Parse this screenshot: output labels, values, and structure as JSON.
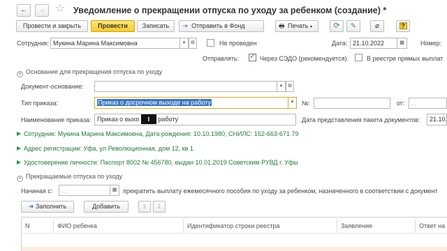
{
  "window": {
    "title": "Уведомление о прекращении отпуска по уходу за ребенком (создание) *"
  },
  "toolbar": {
    "post_close": "Провести и закрыть",
    "post": "Провести",
    "save": "Записать",
    "send_fund": "Отправить в Фонд",
    "print": "Печать"
  },
  "header": {
    "employee_label": "Сотрудник:",
    "employee_value": "Мукина Марина Максимовна",
    "not_posted_label": "Не проведен",
    "date_label": "Дата:",
    "date_value": "21.10.2022",
    "number_label": "Номер:",
    "send_label": "Отправлять:",
    "via_sedo_label": "Через СЭДО (рекомендуется)",
    "registry_label": "В реестре прямых выплат"
  },
  "basis": {
    "section_title": "Основание для прекращения отпуска по уходу",
    "doc_basis_label": "Документ-основание:",
    "doc_basis_value": "",
    "order_type_label": "Тип приказа:",
    "order_type_value": "Приказ о досрочном выходе на работу",
    "number_label": "№:",
    "from_label": "от:",
    "from_value": " .  .",
    "order_name_label": "Наименование приказа:",
    "order_name_part1": "Приказ о выхо",
    "order_name_part2": "работу",
    "package_date_label": "Дата представления пакета документов:",
    "package_date_value": "21.10."
  },
  "links": {
    "employee_info": "Сотрудник: Мукина Марина Максимовна, Дата рождения: 10.10.1980, СНИЛС: 152-663-671 79",
    "address": "Адрес регистрации: Уфа, ул Революционная, дом 12, кв 1",
    "identity": "Удостоверение личности: Паспорт 8002 № 456780, выдан 10.01.2019 Советским РУВД г. Уфы"
  },
  "leaves": {
    "section_title": "Прекращаемые отпуска по уходу",
    "start_label": "Начиная с:",
    "start_value": " .  .",
    "stop_text": "прекратить выплату ежемесячного пособия по уходу за ребенком, назначенного в соответствии с документ",
    "fill_button": "Заполнить",
    "add_button": "Добавить"
  },
  "table": {
    "columns": [
      "N",
      "ФИО ребенка",
      "Идентификатор строки реестра",
      "Заявление",
      "Ответ на"
    ]
  },
  "colors": {
    "accent_yellow": "#f5cc25",
    "link_green": "#1f7a3a",
    "check_green": "#2e9b3e",
    "selection_blue": "#3a75c4"
  }
}
